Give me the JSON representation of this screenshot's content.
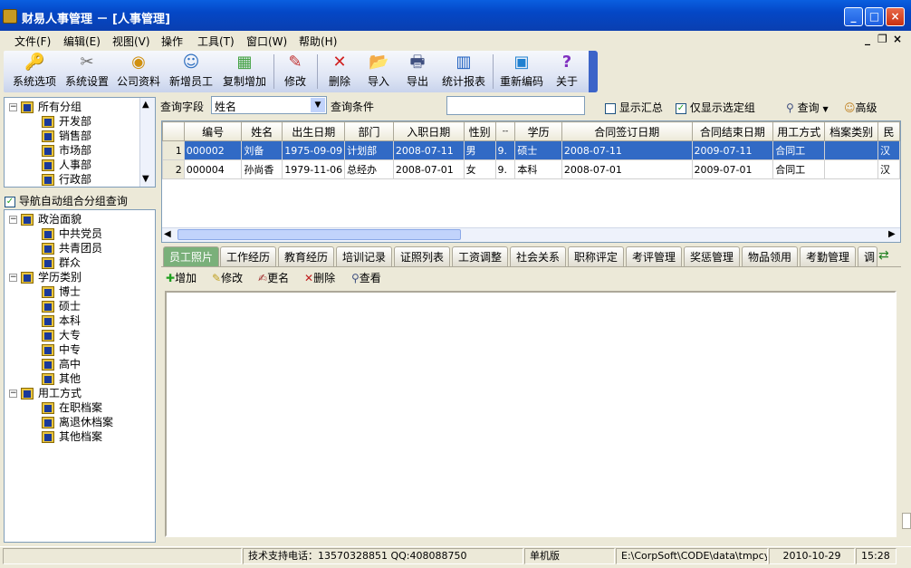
{
  "window": {
    "title": "财易人事管理 － [人事管理]",
    "minimize": "_",
    "maximize": "□",
    "close": "×"
  },
  "menu": [
    "文件(F)",
    "编辑(E)",
    "视图(V)",
    "操作",
    "工具(T)",
    "窗口(W)",
    "帮助(H)"
  ],
  "mdi_controls": [
    "_",
    "❐",
    "×"
  ],
  "toolbar": [
    {
      "label": "系统选项",
      "icon": "key-icon"
    },
    {
      "label": "系统设置",
      "icon": "tools-icon"
    },
    {
      "label": "公司资料",
      "icon": "company-icon"
    },
    {
      "label": "新增员工",
      "icon": "add-user-icon"
    },
    {
      "label": "复制增加",
      "icon": "copy-add-icon"
    },
    {
      "label": "修改",
      "icon": "pencil-icon"
    },
    {
      "label": "删除",
      "icon": "delete-icon"
    },
    {
      "label": "导入",
      "icon": "import-icon"
    },
    {
      "label": "导出",
      "icon": "export-icon"
    },
    {
      "label": "统计报表",
      "icon": "chart-icon"
    },
    {
      "label": "重新编码",
      "icon": "recode-icon"
    },
    {
      "label": "关于",
      "icon": "help-icon"
    }
  ],
  "dept_tree": {
    "root": "所有分组",
    "items": [
      "开发部",
      "销售部",
      "市场部",
      "人事部",
      "行政部"
    ]
  },
  "nav_checkbox": {
    "label": "导航自动组合分组查询",
    "checked": true
  },
  "group_tree": [
    {
      "label": "政治面貌",
      "children": [
        "中共党员",
        "共青团员",
        "群众"
      ]
    },
    {
      "label": "学历类别",
      "children": [
        "博士",
        "硕士",
        "本科",
        "大专",
        "中专",
        "高中",
        "其他"
      ]
    },
    {
      "label": "用工方式",
      "children": [
        "在职档案",
        "离退休档案",
        "其他档案"
      ]
    }
  ],
  "query": {
    "field_label": "查询字段",
    "field_value": "姓名",
    "condition_label": "查询条件",
    "condition_value": "",
    "show_summary": "显示汇总",
    "show_summary_checked": false,
    "only_selected": "仅显示选定组",
    "only_selected_checked": true,
    "query_button": "查询",
    "advanced_button": "高级"
  },
  "grid": {
    "columns": [
      "编号",
      "姓名",
      "出生日期",
      "部门",
      "入职日期",
      "性别",
      "--",
      "学历",
      "合同签订日期",
      "合同结束日期",
      "用工方式",
      "档案类别",
      "民"
    ],
    "rows": [
      {
        "n": "1",
        "cells": [
          "000002",
          "刘备",
          "1975-09-09",
          "计划部",
          "2008-07-11",
          "男",
          "9.",
          "硕士",
          "2008-07-11",
          "2009-07-11",
          "合同工",
          "",
          "汉"
        ]
      },
      {
        "n": "2",
        "cells": [
          "000004",
          "孙尚香",
          "1979-11-06",
          "总经办",
          "2008-07-01",
          "女",
          "9.",
          "本科",
          "2008-07-01",
          "2009-07-01",
          "合同工",
          "",
          "汉"
        ]
      }
    ]
  },
  "tabs": [
    "员工照片",
    "工作经历",
    "教育经历",
    "培训记录",
    "证照列表",
    "工资调整",
    "社会关系",
    "职称评定",
    "考评管理",
    "奖惩管理",
    "物品领用",
    "考勤管理",
    "调"
  ],
  "detail_toolbar": [
    "增加",
    "修改",
    "更名",
    "删除",
    "查看"
  ],
  "status": {
    "support": "技术支持电话：13570328851 QQ:408088750",
    "edition": "单机版",
    "path": "E:\\CorpSoft\\CODE\\data\\tmpcy",
    "date": "2010-10-29",
    "time": "15:28"
  }
}
